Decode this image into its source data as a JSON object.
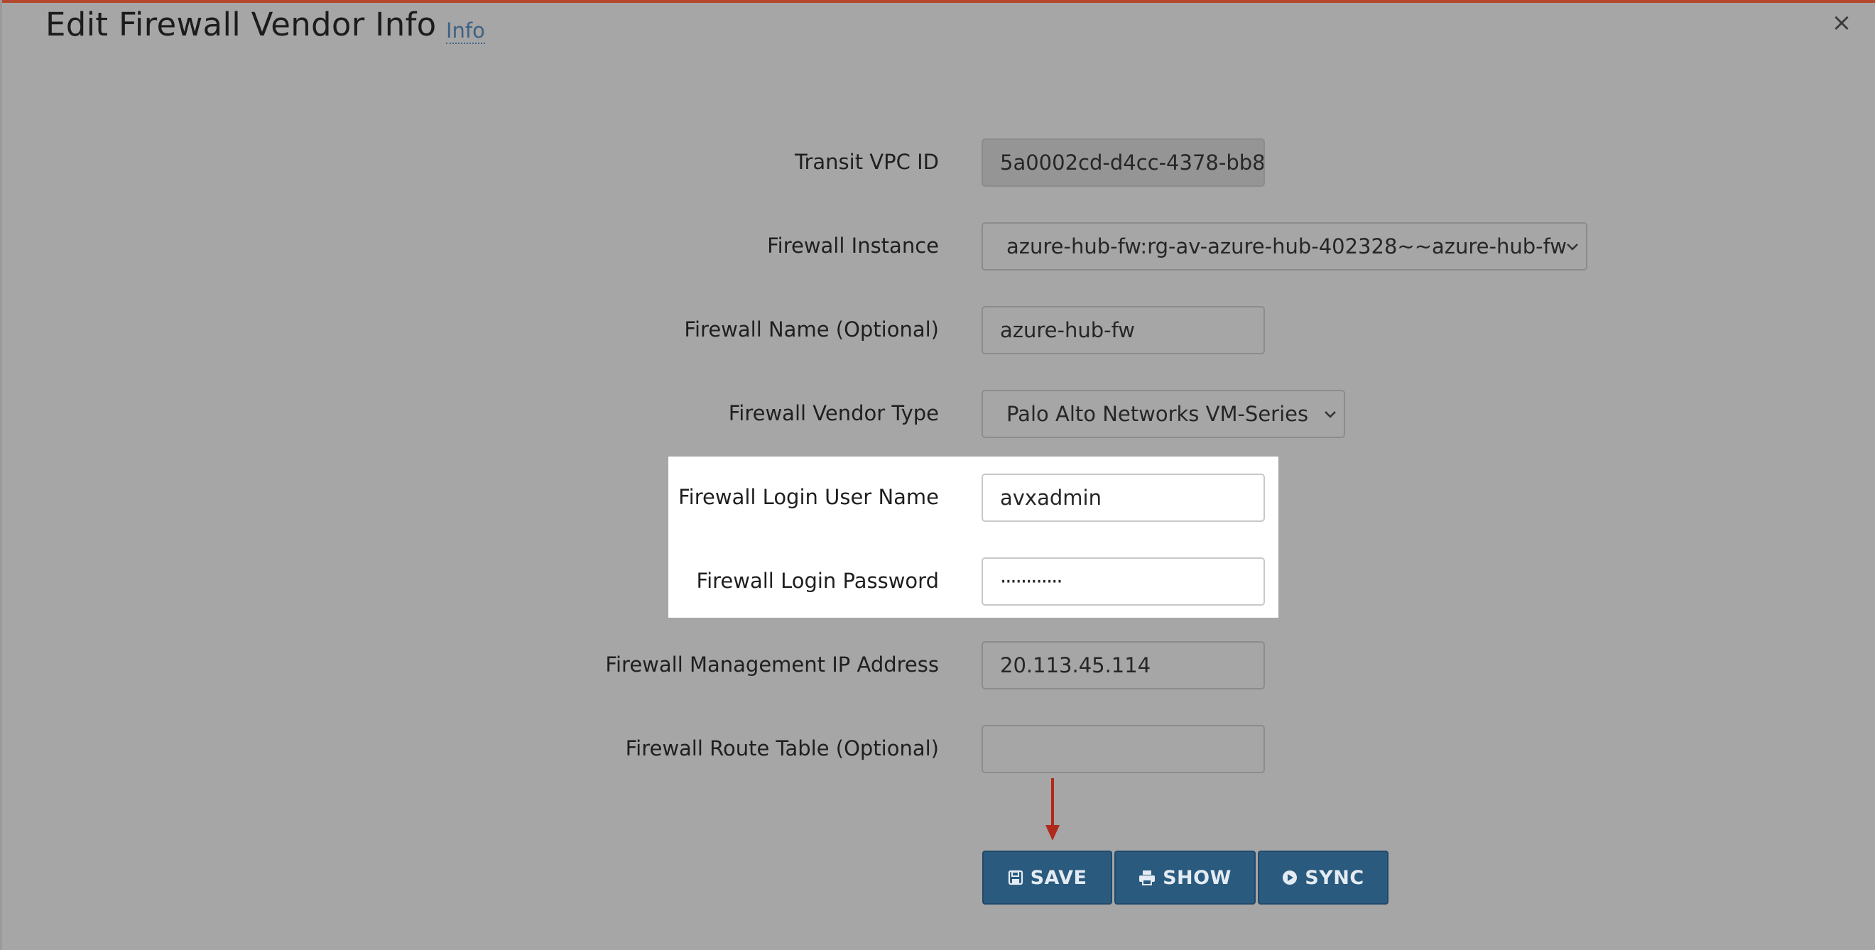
{
  "dialog": {
    "title": "Edit Firewall Vendor Info",
    "info_link": "Info",
    "close_icon": "×"
  },
  "form": {
    "transit_vpc_id": {
      "label": "Transit VPC ID",
      "value": "5a0002cd-d4cc-4378-bb8"
    },
    "firewall_instance": {
      "label": "Firewall Instance",
      "value": "azure-hub-fw:rg-av-azure-hub-402328~~azure-hub-fw"
    },
    "firewall_name": {
      "label": "Firewall Name (Optional)",
      "value": "azure-hub-fw"
    },
    "vendor_type": {
      "label": "Firewall Vendor Type",
      "value": "Palo Alto Networks VM-Series"
    },
    "login_user": {
      "label": "Firewall Login User Name",
      "value": "avxadmin"
    },
    "login_password": {
      "label": "Firewall Login Password",
      "value": "············"
    },
    "mgmt_ip": {
      "label": "Firewall Management IP Address",
      "value": "20.113.45.114"
    },
    "route_table": {
      "label": "Firewall Route Table (Optional)",
      "value": ""
    }
  },
  "buttons": {
    "save": "SAVE",
    "show": "SHOW",
    "sync": "SYNC"
  },
  "colors": {
    "overlay": "#a6a6a6",
    "button": "#2a5a7e",
    "arrow": "#b02a1c",
    "accent": "#b4482c"
  },
  "icons": {
    "save": "floppy-disk-icon",
    "show": "printer-icon",
    "sync": "play-circle-icon"
  }
}
